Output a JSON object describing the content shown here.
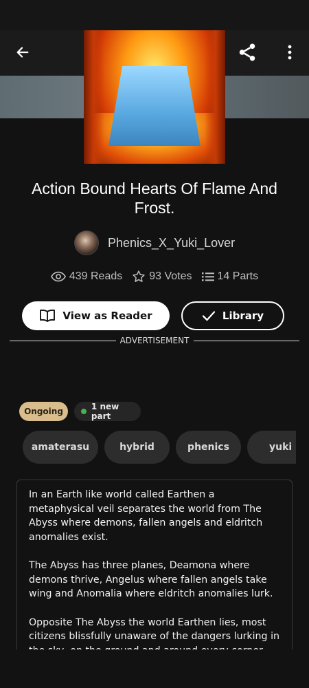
{
  "header": {
    "back_icon": "arrow-left-icon",
    "share_icon": "share-icon",
    "more_icon": "more-vertical-icon"
  },
  "story": {
    "cover_alt": "Story cover with flames and ice",
    "title": "Action Bound Hearts Of Flame And Frost.",
    "author": "Phenics_X_Yuki_Lover",
    "stats": {
      "reads": "439 Reads",
      "votes": "93 Votes",
      "parts": "14 Parts"
    }
  },
  "actions": {
    "view_as_reader": "View as Reader",
    "library": "Library"
  },
  "ad_label": "ADVERTISEMENT",
  "status": {
    "ongoing": "Ongoing",
    "new_part": "1 new part",
    "new_part_dot_color": "#4caf50"
  },
  "tags": [
    "amaterasu",
    "hybrid",
    "phenics",
    "yuki"
  ],
  "description": [
    "In an Earth like world called Earthen a metaphysical veil separates the world from The Abyss where demons, fallen angels and eldritch anomalies exist.",
    "The Abyss has three planes, Deamona where demons thrive, Angelus where fallen angels take wing and Anomalia where eldritch anomalies lurk.",
    "Opposite The Abyss the world Earthen lies, most citizens blissfully unaware of the dangers lurking in the sky, on the ground and around every corner."
  ],
  "colors": {
    "background": "#121212",
    "ongoing_badge": "#d9bd8c",
    "tag_background": "#2d2d2d"
  }
}
